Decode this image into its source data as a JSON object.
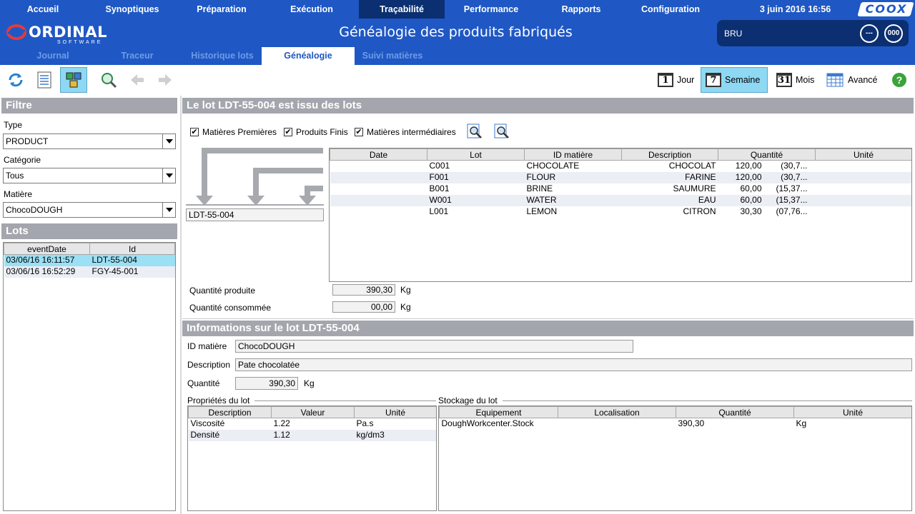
{
  "nav": {
    "items": [
      "Accueil",
      "Synoptiques",
      "Préparation",
      "Exécution",
      "Traçabilité",
      "Performance",
      "Rapports",
      "Configuration"
    ],
    "active": "Traçabilité",
    "date": "3 juin 2016 16:56",
    "brand": "COOX"
  },
  "header": {
    "logo_main": "ORDINAL",
    "logo_sub": "SOFTWARE",
    "title": "Généalogie des produits fabriqués",
    "user": "BRU",
    "btn1": "---",
    "btn2": "000"
  },
  "subnav": {
    "tabs": [
      "Journal",
      "Traceur",
      "Historique lots",
      "Généalogie",
      "Suivi matières"
    ],
    "active": "Généalogie"
  },
  "toolbar": {
    "period": {
      "jour": "Jour",
      "semaine": "Semaine",
      "mois": "Mois",
      "avance": "Avancé",
      "jour_num": "1",
      "semaine_num": "7",
      "mois_num": "31"
    }
  },
  "filter": {
    "title": "Filtre",
    "type_label": "Type",
    "type_value": "PRODUCT",
    "categorie_label": "Catégorie",
    "categorie_value": "Tous",
    "matiere_label": "Matière",
    "matiere_value": "ChocoDOUGH"
  },
  "lots": {
    "title": "Lots",
    "columns": [
      "eventDate",
      "Id"
    ],
    "rows": [
      {
        "date": "03/06/16 16:11:57",
        "id": "LDT-55-004"
      },
      {
        "date": "03/06/16 16:52:29",
        "id": "FGY-45-001"
      }
    ]
  },
  "genealogy": {
    "title": "Le lot  LDT-55-004 est issu des lots",
    "checks": [
      "Matières Premières",
      "Produits Finis",
      "Matières intermédiaires"
    ],
    "lot_box": "LDT-55-004",
    "columns": [
      "Date",
      "Lot",
      "ID matière",
      "Description",
      "Quantité",
      "Unité"
    ],
    "rows": [
      {
        "date": "",
        "lot": "C001",
        "id": "CHOCOLATE",
        "desc": "CHOCOLAT",
        "qty": "120,00",
        "unit": "(30,7..."
      },
      {
        "date": "",
        "lot": "F001",
        "id": "FLOUR",
        "desc": "FARINE",
        "qty": "120,00",
        "unit": "(30,7..."
      },
      {
        "date": "",
        "lot": "B001",
        "id": "BRINE",
        "desc": "SAUMURE",
        "qty": "60,00",
        "unit": "(15,37..."
      },
      {
        "date": "",
        "lot": "W001",
        "id": "WATER",
        "desc": "EAU",
        "qty": "60,00",
        "unit": "(15,37..."
      },
      {
        "date": "",
        "lot": "L001",
        "id": "LEMON",
        "desc": "CITRON",
        "qty": "30,30",
        "unit": "(07,76..."
      }
    ],
    "qty_prod_label": "Quantité produite",
    "qty_prod": "390,30",
    "qty_cons_label": "Quantité consommée",
    "qty_cons": "00,00",
    "unit": "Kg"
  },
  "info": {
    "title": "Informations sur le lot LDT-55-004",
    "id_label": "ID matière",
    "id_value": "ChocoDOUGH",
    "desc_label": "Description",
    "desc_value": "Pate chocolatée",
    "qty_label": "Quantité",
    "qty_value": "390,30",
    "unit": "Kg",
    "props": {
      "title": "Propriétés du lot",
      "columns": [
        "Description",
        "Valeur",
        "Unité"
      ],
      "rows": [
        {
          "d": "Viscosité",
          "v": "1.22",
          "u": "Pa.s"
        },
        {
          "d": "Densité",
          "v": "1.12",
          "u": "kg/dm3"
        }
      ]
    },
    "storage": {
      "title": "Stockage du lot",
      "columns": [
        "Equipement",
        "Localisation",
        "Quantité",
        "Unité"
      ],
      "rows": [
        {
          "e": "DoughWorkcenter.Stock",
          "l": "",
          "q": "390,30",
          "u": "Kg"
        }
      ]
    }
  }
}
